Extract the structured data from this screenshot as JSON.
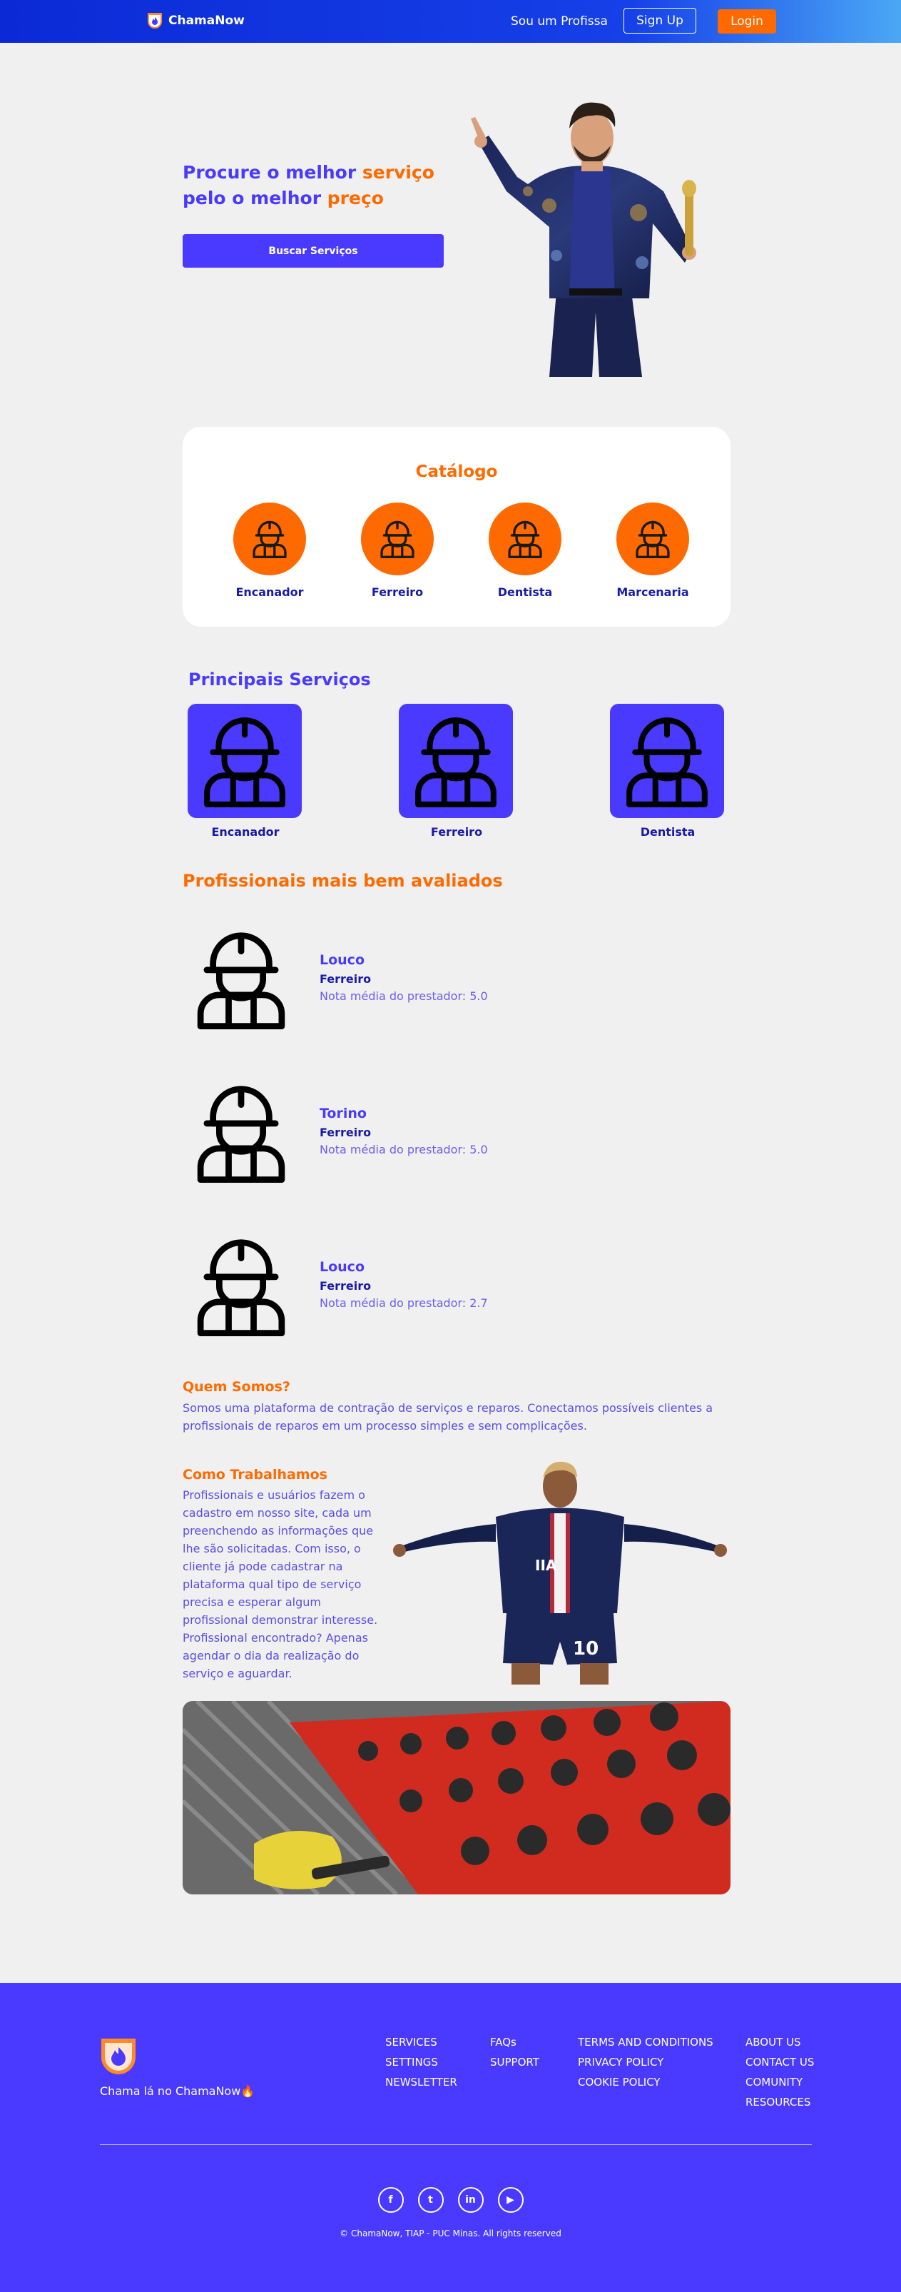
{
  "header": {
    "brand": "ChamaNow",
    "pro_link": "Sou um Profissa",
    "signup": "Sign Up",
    "login": "Login"
  },
  "hero": {
    "title_part1": "Procure o melhor ",
    "title_highlight1": "serviço",
    "title_part2": " pelo o melhor ",
    "title_highlight2": "preço",
    "button": "Buscar Serviços"
  },
  "catalog": {
    "title": "Catálogo",
    "items": [
      {
        "label": "Encanador"
      },
      {
        "label": "Ferreiro"
      },
      {
        "label": "Dentista"
      },
      {
        "label": "Marcenaria"
      }
    ]
  },
  "services": {
    "title": "Principais Serviços",
    "items": [
      {
        "label": "Encanador"
      },
      {
        "label": "Ferreiro"
      },
      {
        "label": "Dentista"
      }
    ]
  },
  "professionals": {
    "title": "Profissionais mais bem avaliados",
    "items": [
      {
        "name": "Louco",
        "job": "Ferreiro",
        "rating": "Nota média do prestador: 5.0"
      },
      {
        "name": "Torino",
        "job": "Ferreiro",
        "rating": "Nota média do prestador: 5.0"
      },
      {
        "name": "Louco",
        "job": "Ferreiro",
        "rating": "Nota média do prestador: 2.7"
      }
    ]
  },
  "about": {
    "title": "Quem Somos?",
    "text": "Somos uma plataforma de contração de serviços e reparos. Conectamos possíveis clientes a profissionais de reparos em um processo simples e sem complicações."
  },
  "how": {
    "title": "Como Trabalhamos",
    "text": "Profissionais e usuários fazem o cadastro em nosso site, cada um preenchendo as informações que lhe são solicitadas. Com isso, o cliente já pode cadastrar na plataforma qual tipo de serviço precisa e esperar algum profissional demonstrar interesse. Profissional encontrado? Apenas agendar o dia da realização do serviço e aguardar."
  },
  "footer": {
    "tagline": "Chama lá no ChamaNow🔥",
    "col1": [
      "SERVICES",
      "SETTINGS",
      "NEWSLETTER"
    ],
    "col2": [
      "FAQs",
      "SUPPORT"
    ],
    "col3": [
      "TERMS AND CONDITIONS",
      "PRIVACY POLICY",
      "COOKIE POLICY"
    ],
    "col4": [
      "ABOUT US",
      "CONTACT US",
      "COMUNITY",
      "RESOURCES"
    ],
    "socials": [
      {
        "icon": "facebook-icon",
        "glyph": "f"
      },
      {
        "icon": "twitter-icon",
        "glyph": "t"
      },
      {
        "icon": "linkedin-icon",
        "glyph": "in"
      },
      {
        "icon": "youtube-icon",
        "glyph": "▶"
      }
    ],
    "copyright": "© ChamaNow, TIAP - PUC Minas. All rights reserved"
  },
  "colors": {
    "primary": "#4a3aff",
    "accent": "#ff6a00",
    "header_start": "#0b2ad6",
    "header_end": "#4aa8f5"
  }
}
